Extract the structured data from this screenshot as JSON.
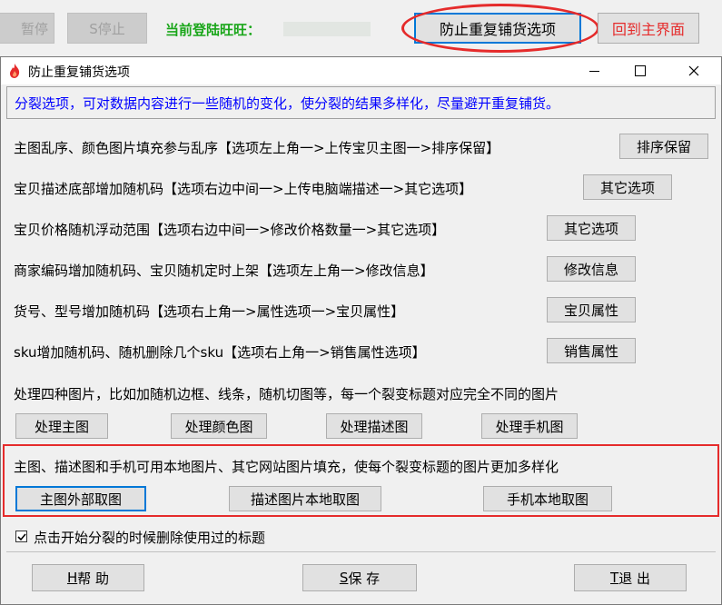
{
  "toolbar": {
    "pause_label": "暂停",
    "stop_label": "S停止",
    "login_label": "当前登陆旺旺：",
    "prevent_label": "防止重复铺货选项",
    "home_label": "回到主界面"
  },
  "dialog": {
    "title": "防止重复铺货选项",
    "intro": "分裂选项，可对数据内容进行一些随机的变化，使分裂的结果多样化，尽量避开重复铺货。",
    "rows": [
      {
        "text": "主图乱序、颜色图片填充参与乱序【选项左上角一>上传宝贝主图一>排序保留】",
        "button": "排序保留"
      },
      {
        "text": "宝贝描述底部增加随机码【选项右边中间一>上传电脑端描述一>其它选项】",
        "button": "其它选项"
      },
      {
        "text": "宝贝价格随机浮动范围【选项右边中间一>修改价格数量一>其它选项】",
        "button": "其它选项"
      },
      {
        "text": "商家编码增加随机码、宝贝随机定时上架【选项左上角一>修改信息】",
        "button": "修改信息"
      },
      {
        "text": "货号、型号增加随机码【选项右上角一>属性选项一>宝贝属性】",
        "button": "宝贝属性"
      },
      {
        "text": "sku增加随机码、随机删除几个sku【选项右上角一>销售属性选项】",
        "button": "销售属性"
      }
    ],
    "image_note": "处理四种图片，比如加随机边框、线条，随机切图等，每一个裂变标题对应完全不同的图片",
    "image_buttons": [
      "处理主图",
      "处理颜色图",
      "处理描述图",
      "处理手机图"
    ],
    "local_note": "主图、描述图和手机可用本地图片、其它网站图片填充，使每个裂变标题的图片更加多样化",
    "local_buttons": [
      "主图外部取图",
      "描述图片本地取图",
      "手机本地取图"
    ],
    "checkbox_label": "点击开始分裂的时候删除使用过的标题",
    "checkbox_checked": true,
    "footer": {
      "help_key": "H",
      "help_text": "帮 助",
      "save_key": "S",
      "save_text": "保 存",
      "exit_key": "T",
      "exit_text": "退 出"
    }
  },
  "colors": {
    "accent_blue": "#0078d7",
    "green_text": "#1aa61a",
    "red_text": "#e52b2b",
    "intro_blue": "#0000ff"
  }
}
